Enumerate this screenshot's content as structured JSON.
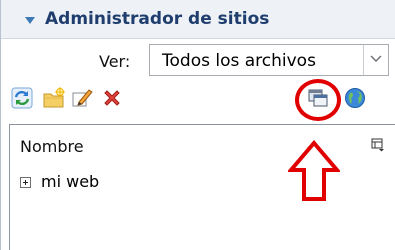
{
  "header": {
    "title": "Administrador de sitios"
  },
  "view": {
    "label": "Ver:",
    "selected": "Todos los archivos"
  },
  "toolbar": {
    "icons": [
      "refresh-icon",
      "new-folder-icon",
      "edit-icon",
      "delete-icon",
      "window-icon",
      "globe-icon"
    ]
  },
  "list": {
    "column_header": "Nombre",
    "items": [
      {
        "label": "mi web"
      }
    ]
  },
  "colors": {
    "header_bg": "#eef2f7",
    "title": "#1f3e6e",
    "annotation": "#e10000"
  }
}
